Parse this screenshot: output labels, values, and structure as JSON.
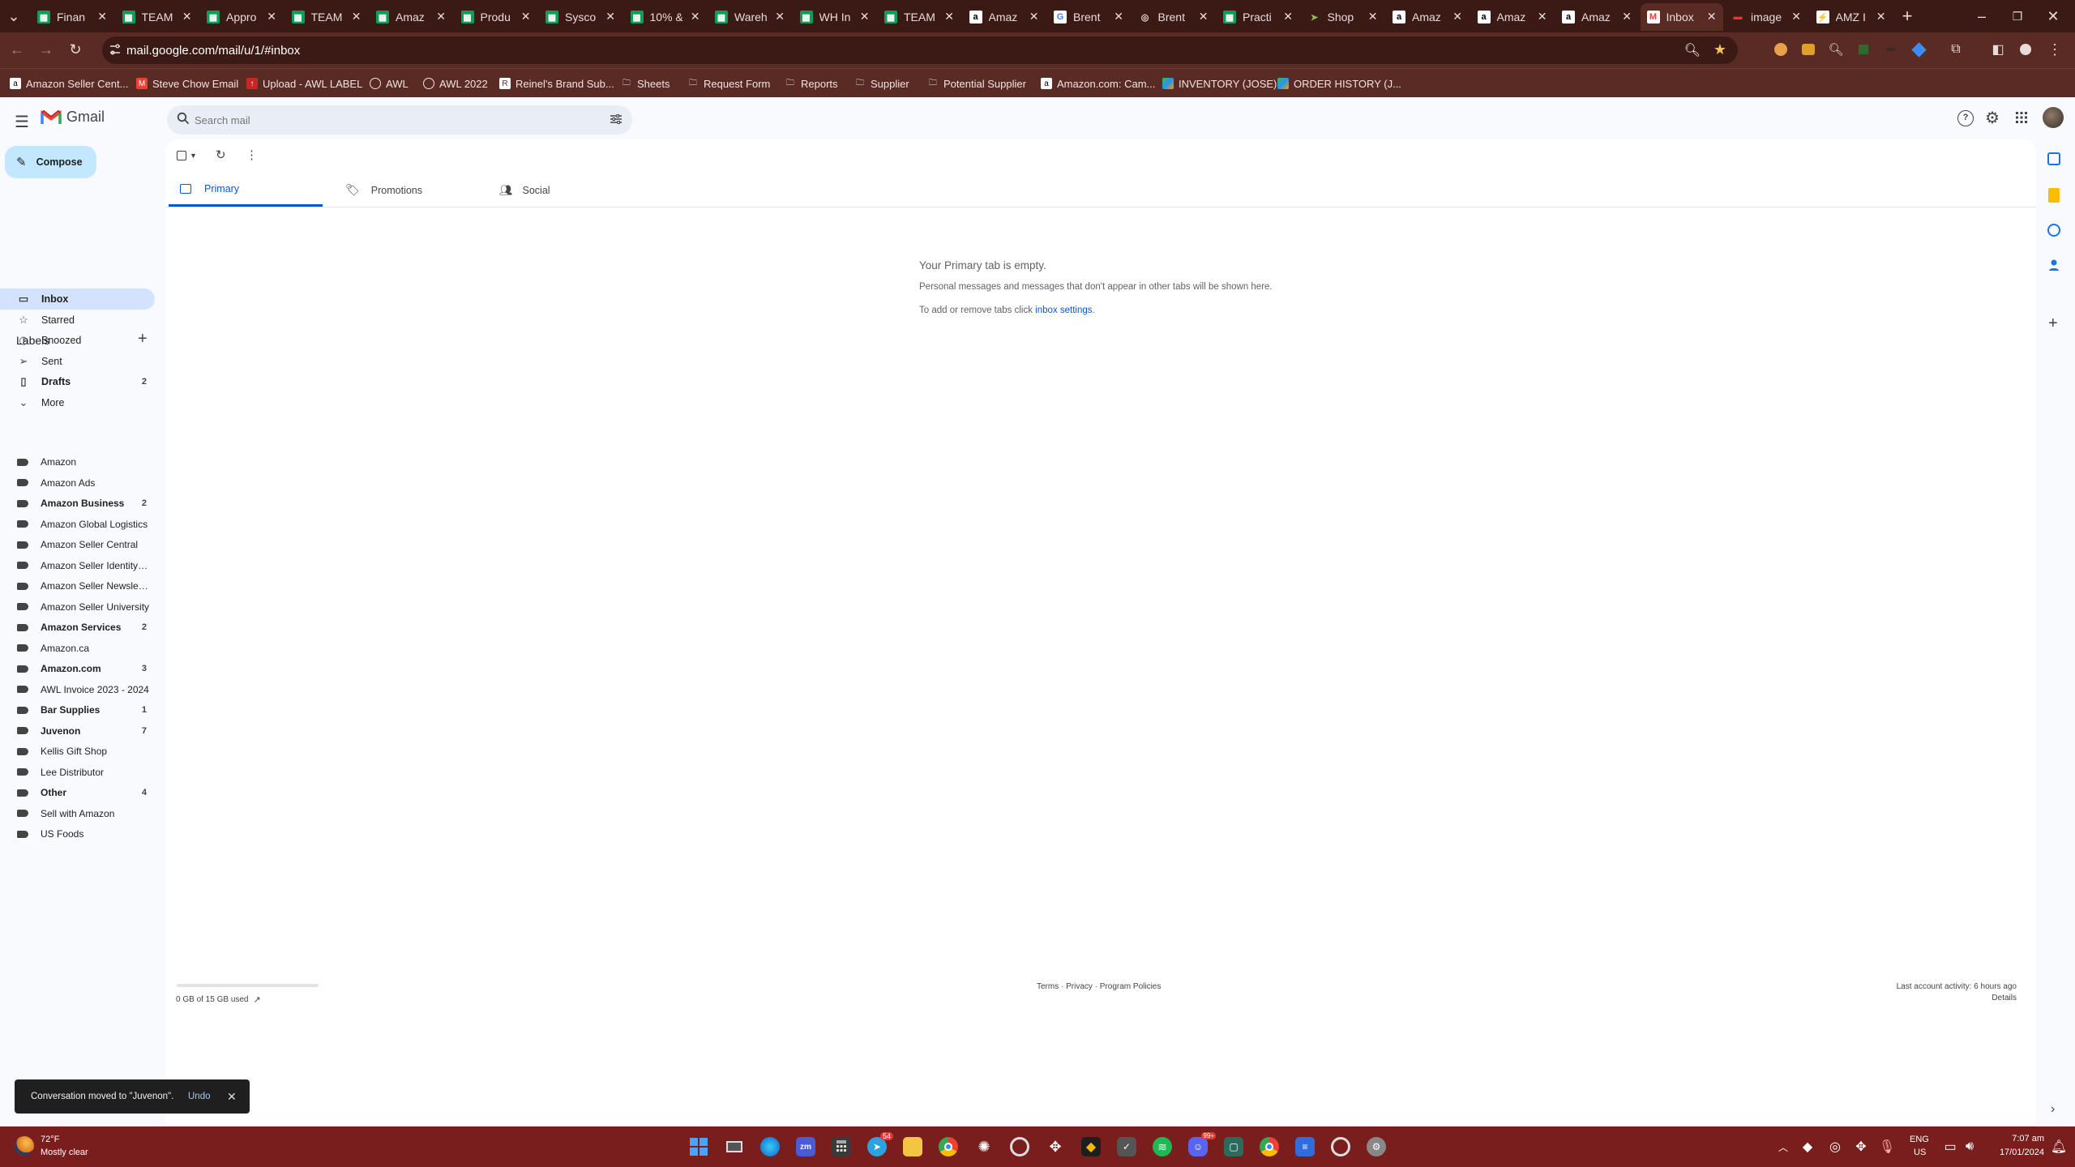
{
  "browser": {
    "tabs": [
      {
        "title": "Finan",
        "icon": "sheets-icon"
      },
      {
        "title": "TEAM",
        "icon": "sheets-icon"
      },
      {
        "title": "Appro",
        "icon": "sheets-icon"
      },
      {
        "title": "TEAM",
        "icon": "sheets-icon"
      },
      {
        "title": "Amaz",
        "icon": "sheets-icon"
      },
      {
        "title": "Produ",
        "icon": "sheets-icon"
      },
      {
        "title": "Sysco",
        "icon": "sheets-icon"
      },
      {
        "title": "10% &",
        "icon": "sheets-icon"
      },
      {
        "title": "Wareh",
        "icon": "sheets-icon"
      },
      {
        "title": "WH In",
        "icon": "sheets-icon"
      },
      {
        "title": "TEAM",
        "icon": "sheets-icon"
      },
      {
        "title": "Amaz",
        "icon": "amazon-icon"
      },
      {
        "title": "Brent",
        "icon": "google-icon"
      },
      {
        "title": "Brent",
        "icon": "globe-icon"
      },
      {
        "title": "Practi",
        "icon": "sheets-icon"
      },
      {
        "title": "Shop",
        "icon": "shop-icon"
      },
      {
        "title": "Amaz",
        "icon": "amazon-icon"
      },
      {
        "title": "Amaz",
        "icon": "amazon-icon"
      },
      {
        "title": "Amaz",
        "icon": "amazon-icon"
      },
      {
        "title": "Inbox",
        "icon": "gmail-icon"
      },
      {
        "title": "image",
        "icon": "image-icon"
      },
      {
        "title": "AMZ I",
        "icon": "amz-icon"
      }
    ],
    "url": "mail.google.com/mail/u/1/#inbox",
    "bookmarks": [
      "Amazon Seller Cent...",
      "Steve Chow Email",
      "Upload - AWL LABEL",
      "AWL",
      "AWL 2022",
      "Reinel's Brand Sub...",
      "Sheets",
      "Request Form",
      "Reports",
      "Supplier",
      "Potential Supplier",
      "Amazon.com: Cam...",
      "INVENTORY (JOSE)",
      "ORDER HISTORY (J..."
    ]
  },
  "gmail": {
    "logo_text": "Gmail",
    "search_placeholder": "Search mail",
    "compose_label": "Compose",
    "nav": [
      {
        "label": "Inbox",
        "count": "",
        "icon": "inbox-icon"
      },
      {
        "label": "Starred",
        "count": "",
        "icon": "star-icon"
      },
      {
        "label": "Snoozed",
        "count": "",
        "icon": "clock-icon"
      },
      {
        "label": "Sent",
        "count": "",
        "icon": "send-icon"
      },
      {
        "label": "Drafts",
        "count": "2",
        "icon": "draft-icon"
      },
      {
        "label": "More",
        "count": "",
        "icon": "chevron-down-icon"
      }
    ],
    "labels_heading": "Labels",
    "labels": [
      {
        "name": "Amazon",
        "count": ""
      },
      {
        "name": "Amazon Ads",
        "count": ""
      },
      {
        "name": "Amazon Business",
        "count": "2"
      },
      {
        "name": "Amazon Global Logistics",
        "count": ""
      },
      {
        "name": "Amazon Seller Central",
        "count": ""
      },
      {
        "name": "Amazon Seller Identity V...",
        "count": ""
      },
      {
        "name": "Amazon Seller Newsletter",
        "count": ""
      },
      {
        "name": "Amazon Seller University",
        "count": ""
      },
      {
        "name": "Amazon Services",
        "count": "2"
      },
      {
        "name": "Amazon.ca",
        "count": ""
      },
      {
        "name": "Amazon.com",
        "count": "3"
      },
      {
        "name": "AWL Invoice 2023 - 2024",
        "count": ""
      },
      {
        "name": "Bar Supplies",
        "count": "1"
      },
      {
        "name": "Juvenon",
        "count": "7"
      },
      {
        "name": "Kellis Gift Shop",
        "count": ""
      },
      {
        "name": "Lee Distributor",
        "count": ""
      },
      {
        "name": "Other",
        "count": "4"
      },
      {
        "name": "Sell with Amazon",
        "count": ""
      },
      {
        "name": "US Foods",
        "count": ""
      }
    ],
    "tabs": [
      {
        "label": "Primary",
        "icon": "inbox-icon"
      },
      {
        "label": "Promotions",
        "icon": "tag-icon"
      },
      {
        "label": "Social",
        "icon": "people-icon"
      }
    ],
    "empty": {
      "title": "Your Primary tab is empty.",
      "line1": "Personal messages and messages that don't appear in other tabs will be shown here.",
      "line2_prefix": "To add or remove tabs click ",
      "line2_link": "inbox settings",
      "line2_suffix": "."
    },
    "footer": {
      "storage": "0 GB of 15 GB used",
      "storage_fraction": 0,
      "policies": "Terms · Privacy · Program Policies",
      "activity": "Last account activity: 6 hours ago",
      "details": "Details"
    },
    "snackbar": {
      "message": "Conversation moved to \"Juvenon\".",
      "undo": "Undo"
    }
  },
  "taskbar": {
    "weather_temp": "72°F",
    "weather_desc": "Mostly clear",
    "lang": "ENG",
    "region": "US",
    "time": "7:07 am",
    "date": "17/01/2024",
    "telegram_badge": "54",
    "discord_badge": "99+"
  },
  "colors": {
    "frame": "#5a2b24",
    "tab_strip": "#3b1a16",
    "taskbar": "#7a1d1d",
    "gmail_selected": "#d3e3fd",
    "compose": "#c2e7ff",
    "primary_blue": "#0b57d0"
  }
}
